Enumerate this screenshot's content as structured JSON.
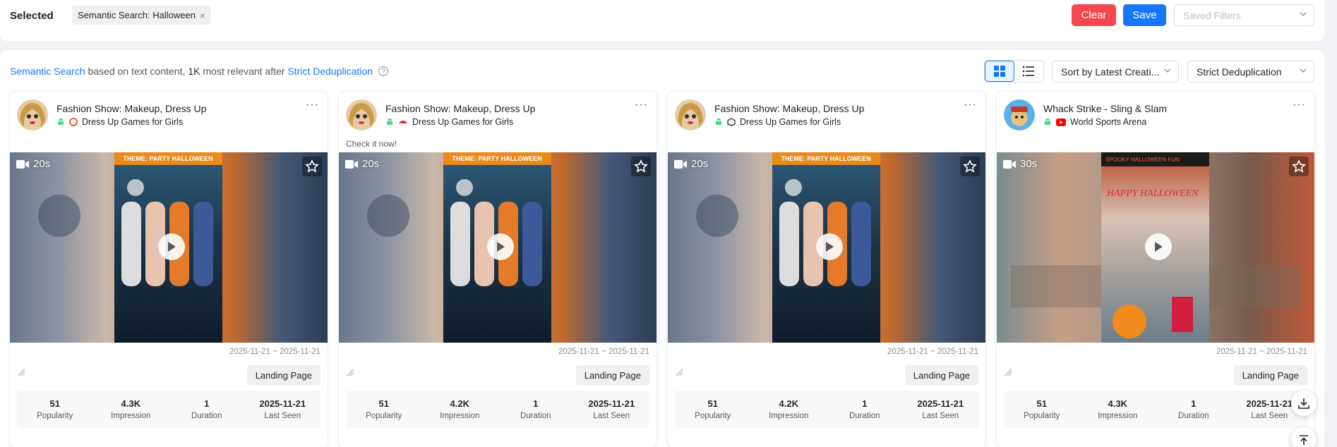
{
  "filters": {
    "selected_label": "Selected",
    "chip_label": "Semantic Search: Halloween",
    "clear_label": "Clear",
    "save_label": "Save",
    "saved_filters_placeholder": "Saved Filters"
  },
  "toolbar": {
    "info_link": "Semantic Search",
    "info_text1": "based on text content,",
    "info_count": "1K",
    "info_text2": "most relevant after",
    "info_dedup_link": "Strict Deduplication",
    "sort_value": "Sort by Latest Creati...",
    "dedup_value": "Strict Deduplication",
    "view_mode": "grid"
  },
  "cards": [
    {
      "title": "Fashion Show: Makeup, Dress Up",
      "publisher": "Dress Up Games for Girls",
      "caption": "",
      "duration": "20s",
      "banner": "THEME: PARTY HALLOWEEN",
      "date_range": "2025-11-21 ~ 2025-11-21",
      "landing_page": "Landing Page",
      "stats": [
        {
          "value": "51",
          "label": "Popularity"
        },
        {
          "value": "4.3K",
          "label": "Impression"
        },
        {
          "value": "1",
          "label": "Duration"
        },
        {
          "value": "2025-11-21",
          "label": "Last Seen"
        }
      ]
    },
    {
      "title": "Fashion Show: Makeup, Dress Up",
      "publisher": "Dress Up Games for Girls",
      "caption": "Check it now!",
      "duration": "20s",
      "banner": "THEME: PARTY HALLOWEEN",
      "date_range": "2025-11-21 ~ 2025-11-21",
      "landing_page": "Landing Page",
      "stats": [
        {
          "value": "51",
          "label": "Popularity"
        },
        {
          "value": "4.2K",
          "label": "Impression"
        },
        {
          "value": "1",
          "label": "Duration"
        },
        {
          "value": "2025-11-21",
          "label": "Last Seen"
        }
      ]
    },
    {
      "title": "Fashion Show: Makeup, Dress Up",
      "publisher": "Dress Up Games for Girls",
      "caption": "",
      "duration": "20s",
      "banner": "THEME: PARTY HALLOWEEN",
      "date_range": "2025-11-21 ~ 2025-11-21",
      "landing_page": "Landing Page",
      "stats": [
        {
          "value": "51",
          "label": "Popularity"
        },
        {
          "value": "4.2K",
          "label": "Impression"
        },
        {
          "value": "1",
          "label": "Duration"
        },
        {
          "value": "2025-11-21",
          "label": "Last Seen"
        }
      ]
    },
    {
      "title": "Whack Strike - Sling & Slam",
      "publisher": "World Sports Arena",
      "caption": "",
      "duration": "30s",
      "banner": "SPOOKY HALLOWEEN FUN",
      "banner2": "HAPPY HALLOWEEN",
      "date_range": "2025-11-21 ~ 2025-11-21",
      "landing_page": "Landing Page",
      "stats": [
        {
          "value": "51",
          "label": "Popularity"
        },
        {
          "value": "4.3K",
          "label": "Impression"
        },
        {
          "value": "1",
          "label": "Duration"
        },
        {
          "value": "2025-11-21",
          "label": "Last Seen"
        }
      ]
    }
  ]
}
